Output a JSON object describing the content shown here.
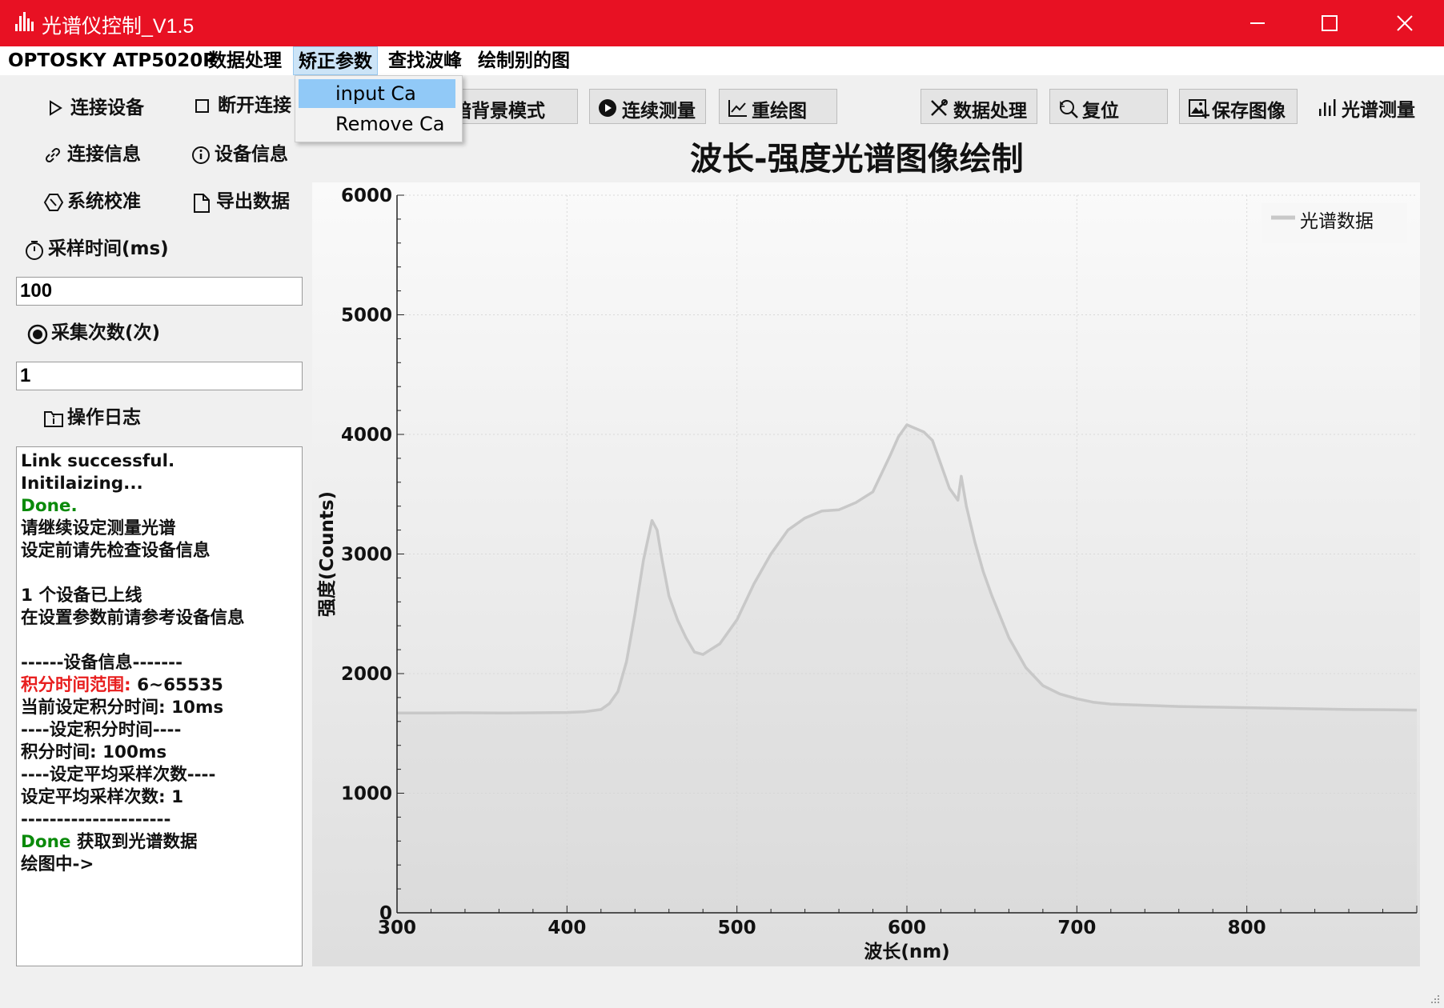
{
  "window": {
    "title": "光谱仪控制_V1.5"
  },
  "menubar": {
    "items": [
      "OPTOSKY ATP5020P",
      "数据处理",
      "矫正参数",
      "查找波峰",
      "绘制别的图"
    ]
  },
  "dropdown": {
    "items": [
      "input Ca",
      "Remove Ca"
    ]
  },
  "sidebar": {
    "connect": "连接设备",
    "disconnect": "断开连接",
    "conn_info": "连接信息",
    "device_info": "设备信息",
    "calibrate": "系统校准",
    "export": "导出数据",
    "sample_time_label": "采样时间(ms)",
    "sample_time_value": "100",
    "sample_count_label": "采集次数(次)",
    "sample_count_value": "1",
    "log_label": "操作日志"
  },
  "log": [
    {
      "text": "Link successful.",
      "color": "#111"
    },
    {
      "text": "Initilaizing...",
      "color": "#111"
    },
    {
      "text": "Done.",
      "color": "#0a8a0a"
    },
    {
      "text": "请继续设定测量光谱",
      "color": "#111"
    },
    {
      "text": "设定前请先检查设备信息",
      "color": "#111"
    },
    {
      "text": "",
      "color": "#111"
    },
    {
      "text": "1 个设备已上线",
      "color": "#111"
    },
    {
      "text": "在设置参数前请参考设备信息",
      "color": "#111"
    },
    {
      "text": "",
      "color": "#111"
    },
    {
      "text": "------设备信息-------",
      "color": "#111"
    },
    {
      "parts": [
        {
          "text": "积分时间范围: ",
          "color": "#e81e1e"
        },
        {
          "text": "6~65535",
          "color": "#111"
        }
      ]
    },
    {
      "text": "当前设定积分时间: 10ms",
      "color": "#111"
    },
    {
      "text": "----设定积分时间----",
      "color": "#111"
    },
    {
      "text": "积分时间: 100ms",
      "color": "#111"
    },
    {
      "text": "----设定平均采样次数----",
      "color": "#111"
    },
    {
      "text": "设定平均采样次数: 1",
      "color": "#111"
    },
    {
      "text": "---------------------",
      "color": "#111"
    },
    {
      "parts": [
        {
          "text": "Done ",
          "color": "#0a8a0a"
        },
        {
          "text": "获取到光谱数据",
          "color": "#111"
        }
      ]
    },
    {
      "text": "绘图中->",
      "color": "#111"
    }
  ],
  "toolbar": {
    "dark": "暗背景模式",
    "continuous": "连续测量",
    "redraw": "重绘图",
    "data_proc": "数据处理",
    "reset": "复位",
    "save_image": "保存图像",
    "measure": "光谱测量"
  },
  "colors": {
    "titlebar": "#e81123",
    "series": "#c8c8c8",
    "ok": "#0a8a0a",
    "warn": "#e81e1e"
  },
  "chart_data": {
    "type": "line",
    "title": "波长-强度光谱图像绘制",
    "xlabel": "波长(nm)",
    "ylabel": "强度(Counts)",
    "xlim": [
      300,
      900
    ],
    "ylim": [
      0,
      6000
    ],
    "xticks": [
      300,
      400,
      500,
      600,
      700,
      800
    ],
    "yticks": [
      0,
      1000,
      2000,
      3000,
      4000,
      5000,
      6000
    ],
    "grid": true,
    "legend": "top-right",
    "series": [
      {
        "name": "光谱数据",
        "x": [
          300,
          320,
          340,
          360,
          380,
          400,
          410,
          420,
          425,
          430,
          435,
          440,
          445,
          450,
          453,
          456,
          460,
          465,
          470,
          475,
          480,
          490,
          500,
          510,
          520,
          530,
          540,
          550,
          560,
          570,
          580,
          590,
          595,
          600,
          605,
          610,
          615,
          620,
          625,
          630,
          632,
          635,
          640,
          645,
          650,
          660,
          670,
          680,
          690,
          700,
          710,
          720,
          730,
          740,
          750,
          760,
          780,
          800,
          820,
          840,
          860,
          880,
          900
        ],
        "values": [
          1670,
          1670,
          1672,
          1670,
          1672,
          1675,
          1680,
          1700,
          1750,
          1850,
          2100,
          2500,
          2950,
          3280,
          3200,
          2950,
          2650,
          2450,
          2300,
          2180,
          2160,
          2250,
          2450,
          2750,
          3000,
          3200,
          3300,
          3360,
          3370,
          3430,
          3520,
          3820,
          3980,
          4080,
          4050,
          4020,
          3950,
          3750,
          3550,
          3450,
          3650,
          3400,
          3100,
          2850,
          2650,
          2300,
          2050,
          1900,
          1830,
          1790,
          1760,
          1745,
          1740,
          1735,
          1730,
          1725,
          1720,
          1715,
          1710,
          1705,
          1700,
          1698,
          1695
        ]
      }
    ]
  }
}
